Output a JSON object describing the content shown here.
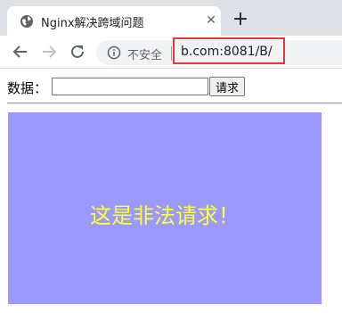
{
  "browser": {
    "tab": {
      "title": "Nginx解决跨域问题",
      "close_glyph": "✕",
      "favicon": "globe-icon"
    },
    "new_tab_glyph": "+",
    "toolbar": {
      "security_label": "不安全",
      "url": "b.com:8081/B/",
      "highlight_color": "#e53935"
    }
  },
  "page": {
    "form": {
      "label": "数据：",
      "input_value": "",
      "submit_label": "请求"
    },
    "panel": {
      "message": "这是非法请求！",
      "background": "#9999ff",
      "text_color": "#ffff33"
    }
  }
}
